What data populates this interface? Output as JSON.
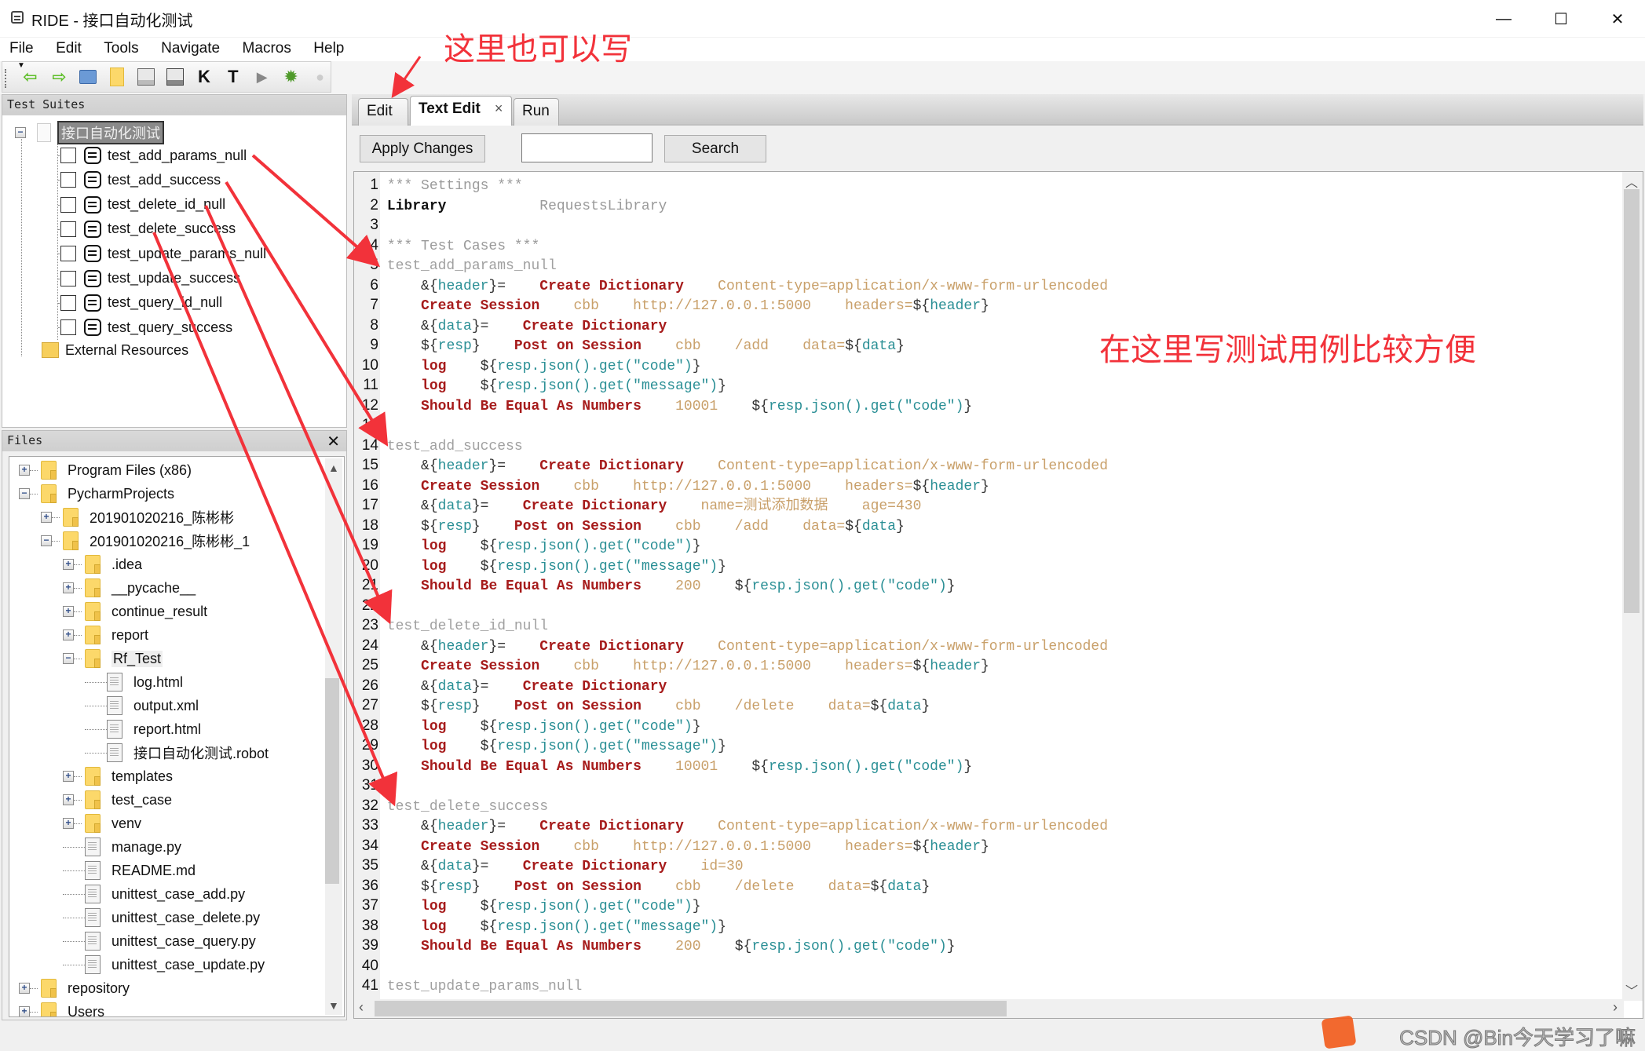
{
  "window": {
    "title": "RIDE - 接口自动化测试",
    "controls": {
      "minimize": "—",
      "maximize": "☐",
      "close": "✕"
    }
  },
  "menu": [
    "File",
    "Edit",
    "Tools",
    "Navigate",
    "Macros",
    "Help"
  ],
  "toolbar": {
    "icons": [
      "back-arrow-icon",
      "forward-arrow-icon",
      "open-suite-icon",
      "open-directory-icon",
      "save-icon",
      "save-all-icon",
      "search-keywords-icon",
      "search-tests-icon",
      "run-icon",
      "debug-bug-icon",
      "stop-icon"
    ]
  },
  "test_suites": {
    "header": "Test Suites",
    "root": "接口自动化测试",
    "tests": [
      "test_add_params_null",
      "test_add_success",
      "test_delete_id_null",
      "test_delete_success",
      "test_update_params_null",
      "test_update_success",
      "test_query_id_null",
      "test_query_success"
    ],
    "external": "External Resources"
  },
  "files": {
    "header": "Files",
    "close": "✕",
    "items": [
      {
        "label": "Program Files (x86)",
        "type": "folder",
        "level": 0,
        "exp": "+"
      },
      {
        "label": "PycharmProjects",
        "type": "folder",
        "level": 0,
        "exp": "−"
      },
      {
        "label": "201901020216_陈彬彬",
        "type": "folder",
        "level": 1,
        "exp": "+"
      },
      {
        "label": "201901020216_陈彬彬_1",
        "type": "folder",
        "level": 1,
        "exp": "−"
      },
      {
        "label": ".idea",
        "type": "folder",
        "level": 2,
        "exp": "+"
      },
      {
        "label": "__pycache__",
        "type": "folder",
        "level": 2,
        "exp": "+"
      },
      {
        "label": "continue_result",
        "type": "folder",
        "level": 2,
        "exp": "+"
      },
      {
        "label": "report",
        "type": "folder",
        "level": 2,
        "exp": "+"
      },
      {
        "label": "Rf_Test",
        "type": "folder",
        "level": 2,
        "exp": "−",
        "selected": true
      },
      {
        "label": "log.html",
        "type": "file",
        "level": 3
      },
      {
        "label": "output.xml",
        "type": "file",
        "level": 3
      },
      {
        "label": "report.html",
        "type": "file",
        "level": 3
      },
      {
        "label": "接口自动化测试.robot",
        "type": "file",
        "level": 3
      },
      {
        "label": "templates",
        "type": "folder",
        "level": 2,
        "exp": "+"
      },
      {
        "label": "test_case",
        "type": "folder",
        "level": 2,
        "exp": "+"
      },
      {
        "label": "venv",
        "type": "folder",
        "level": 2,
        "exp": "+"
      },
      {
        "label": "manage.py",
        "type": "file",
        "level": 2
      },
      {
        "label": "README.md",
        "type": "file",
        "level": 2
      },
      {
        "label": "unittest_case_add.py",
        "type": "file",
        "level": 2
      },
      {
        "label": "unittest_case_delete.py",
        "type": "file",
        "level": 2
      },
      {
        "label": "unittest_case_query.py",
        "type": "file",
        "level": 2
      },
      {
        "label": "unittest_case_update.py",
        "type": "file",
        "level": 2
      },
      {
        "label": "repository",
        "type": "folder",
        "level": 0,
        "exp": "+"
      },
      {
        "label": "Users",
        "type": "folder",
        "level": 0,
        "exp": "+"
      }
    ]
  },
  "tabs": [
    {
      "label": "Edit",
      "active": false
    },
    {
      "label": "Text Edit",
      "active": true,
      "close": "×"
    },
    {
      "label": "Run",
      "active": false
    }
  ],
  "editor_toolbar": {
    "apply_label": "Apply Changes",
    "search_value": "",
    "search_label": "Search"
  },
  "editor": {
    "lines": [
      [
        [
          "comment",
          "*** Settings ***"
        ]
      ],
      [
        [
          "setting",
          "Library"
        ],
        [
          "plain",
          "           "
        ],
        [
          "comment",
          "RequestsLibrary"
        ]
      ],
      [],
      [
        [
          "comment",
          "*** Test Cases ***"
        ]
      ],
      [
        [
          "testname",
          "test_add_params_null"
        ]
      ],
      [
        [
          "plain",
          "    "
        ],
        [
          "sym",
          "&{"
        ],
        [
          "var",
          "header"
        ],
        [
          "sym",
          "}="
        ],
        [
          "plain",
          "    "
        ],
        [
          "kw",
          "Create Dictionary"
        ],
        [
          "plain",
          "    "
        ],
        [
          "arg",
          "Content-type=application/x-www-form-urlencoded"
        ]
      ],
      [
        [
          "plain",
          "    "
        ],
        [
          "kw",
          "Create Session"
        ],
        [
          "plain",
          "    "
        ],
        [
          "arg",
          "cbb"
        ],
        [
          "plain",
          "    "
        ],
        [
          "arg",
          "http://127.0.0.1:5000"
        ],
        [
          "plain",
          "    "
        ],
        [
          "arg",
          "headers="
        ],
        [
          "sym",
          "${"
        ],
        [
          "var",
          "header"
        ],
        [
          "sym",
          "}"
        ]
      ],
      [
        [
          "plain",
          "    "
        ],
        [
          "sym",
          "&{"
        ],
        [
          "var",
          "data"
        ],
        [
          "sym",
          "}="
        ],
        [
          "plain",
          "    "
        ],
        [
          "kw",
          "Create Dictionary"
        ]
      ],
      [
        [
          "plain",
          "    "
        ],
        [
          "sym",
          "${"
        ],
        [
          "var",
          "resp"
        ],
        [
          "sym",
          "}"
        ],
        [
          "plain",
          "    "
        ],
        [
          "kw",
          "Post on Session"
        ],
        [
          "plain",
          "    "
        ],
        [
          "arg",
          "cbb"
        ],
        [
          "plain",
          "    "
        ],
        [
          "arg",
          "/add"
        ],
        [
          "plain",
          "    "
        ],
        [
          "arg",
          "data="
        ],
        [
          "sym",
          "${"
        ],
        [
          "var",
          "data"
        ],
        [
          "sym",
          "}"
        ]
      ],
      [
        [
          "plain",
          "    "
        ],
        [
          "kw",
          "log"
        ],
        [
          "plain",
          "    "
        ],
        [
          "sym",
          "${"
        ],
        [
          "var",
          "resp.json().get(\"code\")"
        ],
        [
          "sym",
          "}"
        ]
      ],
      [
        [
          "plain",
          "    "
        ],
        [
          "kw",
          "log"
        ],
        [
          "plain",
          "    "
        ],
        [
          "sym",
          "${"
        ],
        [
          "var",
          "resp.json().get(\"message\")"
        ],
        [
          "sym",
          "}"
        ]
      ],
      [
        [
          "plain",
          "    "
        ],
        [
          "kw",
          "Should Be Equal As Numbers"
        ],
        [
          "plain",
          "    "
        ],
        [
          "arg",
          "10001"
        ],
        [
          "plain",
          "    "
        ],
        [
          "sym",
          "${"
        ],
        [
          "var",
          "resp.json().get(\"code\")"
        ],
        [
          "sym",
          "}"
        ]
      ],
      [],
      [
        [
          "testname",
          "test_add_success"
        ]
      ],
      [
        [
          "plain",
          "    "
        ],
        [
          "sym",
          "&{"
        ],
        [
          "var",
          "header"
        ],
        [
          "sym",
          "}="
        ],
        [
          "plain",
          "    "
        ],
        [
          "kw",
          "Create Dictionary"
        ],
        [
          "plain",
          "    "
        ],
        [
          "arg",
          "Content-type=application/x-www-form-urlencoded"
        ]
      ],
      [
        [
          "plain",
          "    "
        ],
        [
          "kw",
          "Create Session"
        ],
        [
          "plain",
          "    "
        ],
        [
          "arg",
          "cbb"
        ],
        [
          "plain",
          "    "
        ],
        [
          "arg",
          "http://127.0.0.1:5000"
        ],
        [
          "plain",
          "    "
        ],
        [
          "arg",
          "headers="
        ],
        [
          "sym",
          "${"
        ],
        [
          "var",
          "header"
        ],
        [
          "sym",
          "}"
        ]
      ],
      [
        [
          "plain",
          "    "
        ],
        [
          "sym",
          "&{"
        ],
        [
          "var",
          "data"
        ],
        [
          "sym",
          "}="
        ],
        [
          "plain",
          "    "
        ],
        [
          "kw",
          "Create Dictionary"
        ],
        [
          "plain",
          "    "
        ],
        [
          "arg",
          "name=测试添加数据"
        ],
        [
          "plain",
          "    "
        ],
        [
          "arg",
          "age=430"
        ]
      ],
      [
        [
          "plain",
          "    "
        ],
        [
          "sym",
          "${"
        ],
        [
          "var",
          "resp"
        ],
        [
          "sym",
          "}"
        ],
        [
          "plain",
          "    "
        ],
        [
          "kw",
          "Post on Session"
        ],
        [
          "plain",
          "    "
        ],
        [
          "arg",
          "cbb"
        ],
        [
          "plain",
          "    "
        ],
        [
          "arg",
          "/add"
        ],
        [
          "plain",
          "    "
        ],
        [
          "arg",
          "data="
        ],
        [
          "sym",
          "${"
        ],
        [
          "var",
          "data"
        ],
        [
          "sym",
          "}"
        ]
      ],
      [
        [
          "plain",
          "    "
        ],
        [
          "kw",
          "log"
        ],
        [
          "plain",
          "    "
        ],
        [
          "sym",
          "${"
        ],
        [
          "var",
          "resp.json().get(\"code\")"
        ],
        [
          "sym",
          "}"
        ]
      ],
      [
        [
          "plain",
          "    "
        ],
        [
          "kw",
          "log"
        ],
        [
          "plain",
          "    "
        ],
        [
          "sym",
          "${"
        ],
        [
          "var",
          "resp.json().get(\"message\")"
        ],
        [
          "sym",
          "}"
        ]
      ],
      [
        [
          "plain",
          "    "
        ],
        [
          "kw",
          "Should Be Equal As Numbers"
        ],
        [
          "plain",
          "    "
        ],
        [
          "arg",
          "200"
        ],
        [
          "plain",
          "    "
        ],
        [
          "sym",
          "${"
        ],
        [
          "var",
          "resp.json().get(\"code\")"
        ],
        [
          "sym",
          "}"
        ]
      ],
      [],
      [
        [
          "testname",
          "test_delete_id_null"
        ]
      ],
      [
        [
          "plain",
          "    "
        ],
        [
          "sym",
          "&{"
        ],
        [
          "var",
          "header"
        ],
        [
          "sym",
          "}="
        ],
        [
          "plain",
          "    "
        ],
        [
          "kw",
          "Create Dictionary"
        ],
        [
          "plain",
          "    "
        ],
        [
          "arg",
          "Content-type=application/x-www-form-urlencoded"
        ]
      ],
      [
        [
          "plain",
          "    "
        ],
        [
          "kw",
          "Create Session"
        ],
        [
          "plain",
          "    "
        ],
        [
          "arg",
          "cbb"
        ],
        [
          "plain",
          "    "
        ],
        [
          "arg",
          "http://127.0.0.1:5000"
        ],
        [
          "plain",
          "    "
        ],
        [
          "arg",
          "headers="
        ],
        [
          "sym",
          "${"
        ],
        [
          "var",
          "header"
        ],
        [
          "sym",
          "}"
        ]
      ],
      [
        [
          "plain",
          "    "
        ],
        [
          "sym",
          "&{"
        ],
        [
          "var",
          "data"
        ],
        [
          "sym",
          "}="
        ],
        [
          "plain",
          "    "
        ],
        [
          "kw",
          "Create Dictionary"
        ]
      ],
      [
        [
          "plain",
          "    "
        ],
        [
          "sym",
          "${"
        ],
        [
          "var",
          "resp"
        ],
        [
          "sym",
          "}"
        ],
        [
          "plain",
          "    "
        ],
        [
          "kw",
          "Post on Session"
        ],
        [
          "plain",
          "    "
        ],
        [
          "arg",
          "cbb"
        ],
        [
          "plain",
          "    "
        ],
        [
          "arg",
          "/delete"
        ],
        [
          "plain",
          "    "
        ],
        [
          "arg",
          "data="
        ],
        [
          "sym",
          "${"
        ],
        [
          "var",
          "data"
        ],
        [
          "sym",
          "}"
        ]
      ],
      [
        [
          "plain",
          "    "
        ],
        [
          "kw",
          "log"
        ],
        [
          "plain",
          "    "
        ],
        [
          "sym",
          "${"
        ],
        [
          "var",
          "resp.json().get(\"code\")"
        ],
        [
          "sym",
          "}"
        ]
      ],
      [
        [
          "plain",
          "    "
        ],
        [
          "kw",
          "log"
        ],
        [
          "plain",
          "    "
        ],
        [
          "sym",
          "${"
        ],
        [
          "var",
          "resp.json().get(\"message\")"
        ],
        [
          "sym",
          "}"
        ]
      ],
      [
        [
          "plain",
          "    "
        ],
        [
          "kw",
          "Should Be Equal As Numbers"
        ],
        [
          "plain",
          "    "
        ],
        [
          "arg",
          "10001"
        ],
        [
          "plain",
          "    "
        ],
        [
          "sym",
          "${"
        ],
        [
          "var",
          "resp.json().get(\"code\")"
        ],
        [
          "sym",
          "}"
        ]
      ],
      [],
      [
        [
          "testname",
          "test_delete_success"
        ]
      ],
      [
        [
          "plain",
          "    "
        ],
        [
          "sym",
          "&{"
        ],
        [
          "var",
          "header"
        ],
        [
          "sym",
          "}="
        ],
        [
          "plain",
          "    "
        ],
        [
          "kw",
          "Create Dictionary"
        ],
        [
          "plain",
          "    "
        ],
        [
          "arg",
          "Content-type=application/x-www-form-urlencoded"
        ]
      ],
      [
        [
          "plain",
          "    "
        ],
        [
          "kw",
          "Create Session"
        ],
        [
          "plain",
          "    "
        ],
        [
          "arg",
          "cbb"
        ],
        [
          "plain",
          "    "
        ],
        [
          "arg",
          "http://127.0.0.1:5000"
        ],
        [
          "plain",
          "    "
        ],
        [
          "arg",
          "headers="
        ],
        [
          "sym",
          "${"
        ],
        [
          "var",
          "header"
        ],
        [
          "sym",
          "}"
        ]
      ],
      [
        [
          "plain",
          "    "
        ],
        [
          "sym",
          "&{"
        ],
        [
          "var",
          "data"
        ],
        [
          "sym",
          "}="
        ],
        [
          "plain",
          "    "
        ],
        [
          "kw",
          "Create Dictionary"
        ],
        [
          "plain",
          "    "
        ],
        [
          "arg",
          "id=30"
        ]
      ],
      [
        [
          "plain",
          "    "
        ],
        [
          "sym",
          "${"
        ],
        [
          "var",
          "resp"
        ],
        [
          "sym",
          "}"
        ],
        [
          "plain",
          "    "
        ],
        [
          "kw",
          "Post on Session"
        ],
        [
          "plain",
          "    "
        ],
        [
          "arg",
          "cbb"
        ],
        [
          "plain",
          "    "
        ],
        [
          "arg",
          "/delete"
        ],
        [
          "plain",
          "    "
        ],
        [
          "arg",
          "data="
        ],
        [
          "sym",
          "${"
        ],
        [
          "var",
          "data"
        ],
        [
          "sym",
          "}"
        ]
      ],
      [
        [
          "plain",
          "    "
        ],
        [
          "kw",
          "log"
        ],
        [
          "plain",
          "    "
        ],
        [
          "sym",
          "${"
        ],
        [
          "var",
          "resp.json().get(\"code\")"
        ],
        [
          "sym",
          "}"
        ]
      ],
      [
        [
          "plain",
          "    "
        ],
        [
          "kw",
          "log"
        ],
        [
          "plain",
          "    "
        ],
        [
          "sym",
          "${"
        ],
        [
          "var",
          "resp.json().get(\"message\")"
        ],
        [
          "sym",
          "}"
        ]
      ],
      [
        [
          "plain",
          "    "
        ],
        [
          "kw",
          "Should Be Equal As Numbers"
        ],
        [
          "plain",
          "    "
        ],
        [
          "arg",
          "200"
        ],
        [
          "plain",
          "    "
        ],
        [
          "sym",
          "${"
        ],
        [
          "var",
          "resp.json().get(\"code\")"
        ],
        [
          "sym",
          "}"
        ]
      ],
      [],
      [
        [
          "testname",
          "test_update_params_null"
        ]
      ]
    ]
  },
  "annotations": {
    "top": "这里也可以写",
    "editor": "在这里写测试用例比较方便",
    "color": "#f2323a"
  },
  "watermark": "CSDN @Bin今天学习了嘛"
}
